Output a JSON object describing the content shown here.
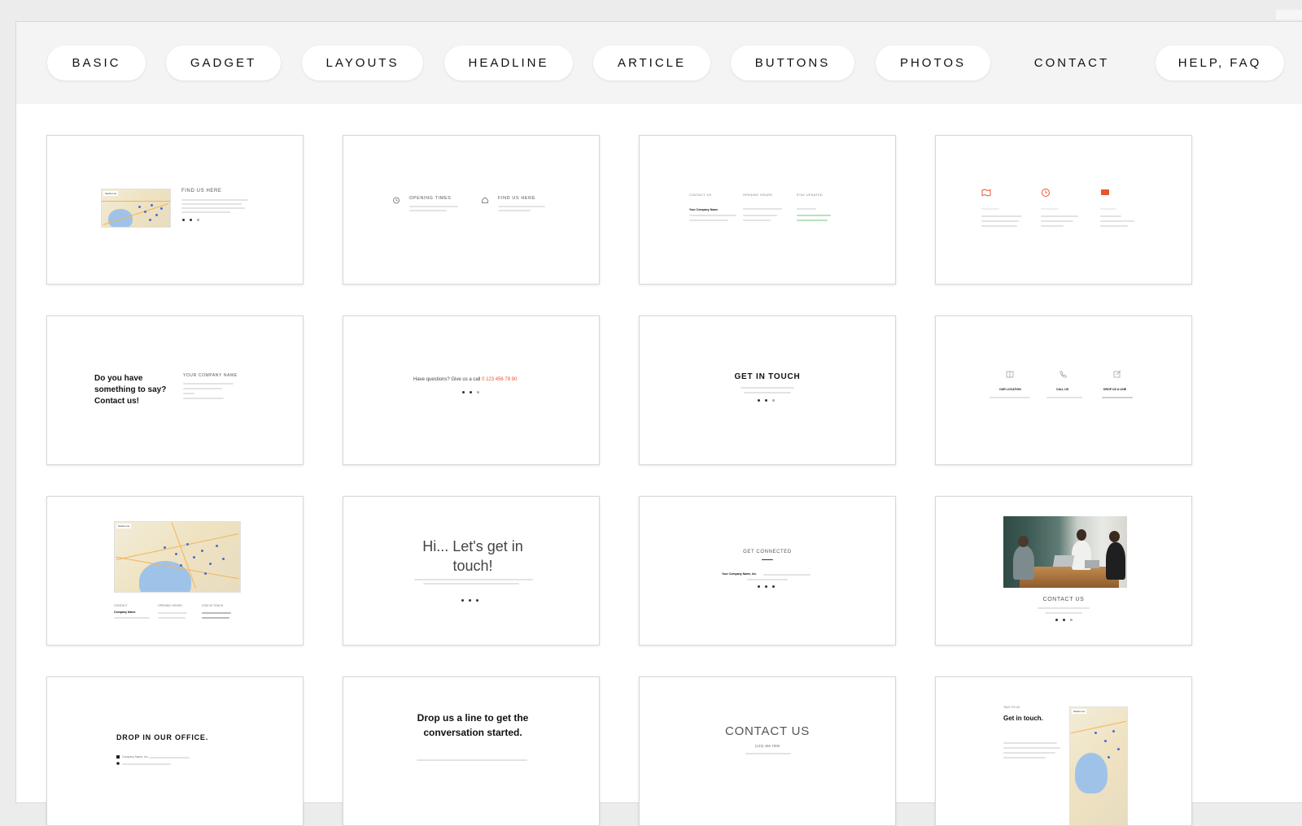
{
  "tabs": [
    {
      "label": "BASIC"
    },
    {
      "label": "GADGET"
    },
    {
      "label": "LAYOUTS"
    },
    {
      "label": "HEADLINE"
    },
    {
      "label": "ARTICLE"
    },
    {
      "label": "BUTTONS"
    },
    {
      "label": "PHOTOS"
    },
    {
      "label": "CONTACT",
      "active": true
    },
    {
      "label": "HELP, FAQ"
    }
  ],
  "cards": {
    "c1": {
      "heading": "FIND US HERE",
      "map_label": "Melbourne"
    },
    "c2": {
      "col1_heading": "OPENING TIMES",
      "col2_heading": "FIND US HERE"
    },
    "c3": {
      "col1_heading": "CONTACT US",
      "col2_heading": "OPENING HOURS",
      "col3_heading": "STAY UPDATED",
      "company": "Your Company Name"
    },
    "c4": {},
    "c5": {
      "headline": "Do you have something to say? Contact us!",
      "company_heading": "YOUR COMPANY NAME"
    },
    "c6": {
      "question": "Have questions? Give us a call",
      "phone": "0 123 456 78 90"
    },
    "c7": {
      "headline": "GET IN TOUCH"
    },
    "c8": {
      "col1_heading": "OUR LOCATION",
      "col2_heading": "CALL US",
      "col3_heading": "DROP US A LINE"
    },
    "c9": {
      "col1_heading": "CONTACT",
      "col2_heading": "OPENING HOURS",
      "col3_heading": "STAY IN TOUCH",
      "company": "Company Name",
      "map_label": "Melbourne"
    },
    "c10": {
      "headline": "Hi... Let's get in touch!"
    },
    "c11": {
      "heading": "GET CONNECTED",
      "company": "Your Company Name, Inc."
    },
    "c12": {
      "heading": "CONTACT US"
    },
    "c13": {
      "headline": "DROP IN OUR OFFICE.",
      "company": "Company Name, Inc."
    },
    "c14": {
      "headline": "Drop us a line to get the conversation started."
    },
    "c15": {
      "headline": "CONTACT US",
      "phone": "(123) 456 7890"
    },
    "c16": {
      "heading": "Get in touch.",
      "small_heading": "TALK TO US",
      "map_label": "Melbourne"
    }
  },
  "colors": {
    "accent": "#e8552d",
    "link_green": "#4caf50",
    "tabbar_bg": "#f4f4f4"
  }
}
